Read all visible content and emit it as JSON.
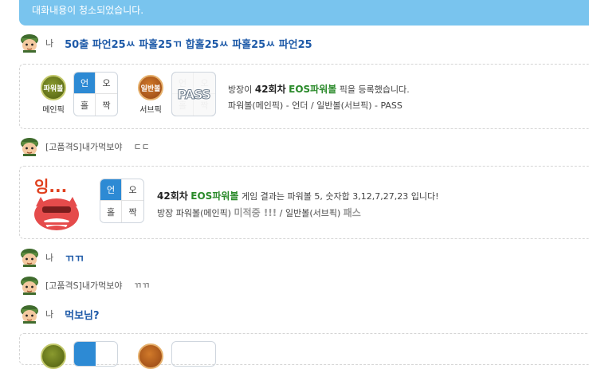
{
  "notice": {
    "text": "대화내용이 청소되었습니다."
  },
  "messages": [
    {
      "user": "나",
      "text": "50출 파언25ㅆ 파홀25ㄲ 합홀25ㅆ 파홀25ㅆ 파언25"
    },
    {
      "user": "[고품격S]내가먹보야",
      "text": "ㄷㄷ"
    },
    {
      "user": "나",
      "text": "ㄲㄲ"
    },
    {
      "user": "[고품격S]내가먹보야",
      "text": "ㄲㄲ"
    },
    {
      "user": "나",
      "text": "먹보님?"
    }
  ],
  "pick_card": {
    "main_badge": "파워볼",
    "main_label": "메인픽",
    "main_grid": [
      "언",
      "오",
      "홀",
      "짝"
    ],
    "sub_badge": "일반볼",
    "sub_label": "서브픽",
    "pass_text": "PASS",
    "pass_grid": [
      "언",
      "오",
      "홀",
      "짝"
    ],
    "line1": {
      "prefix": "방장이 ",
      "round": "42회차",
      "game": "EOS파워볼",
      "suffix": " 픽을 등록했습니다."
    },
    "line2": "파워볼(메인픽) - 언더 / 일반볼(서브픽) - PASS"
  },
  "result_card": {
    "mascot_text": "잉...",
    "grid": [
      "언",
      "오",
      "홀",
      "짝"
    ],
    "line1": {
      "round": "42회차",
      "game": "EOS파워볼",
      "suffix": " 게임 결과는 파워볼 5, 숫자합 3,12,7,27,23 입니다!"
    },
    "line2": {
      "prefix": "방장 파워볼(메인픽) ",
      "status": "미적중 !!!",
      "mid": " / 일반볼(서브픽) ",
      "pass": "패스"
    }
  },
  "colors": {
    "notice_bg": "#79c4ee",
    "selected": "#2d8ad4",
    "link_text": "#1e5aa8",
    "game_name": "#2a8a2a"
  }
}
